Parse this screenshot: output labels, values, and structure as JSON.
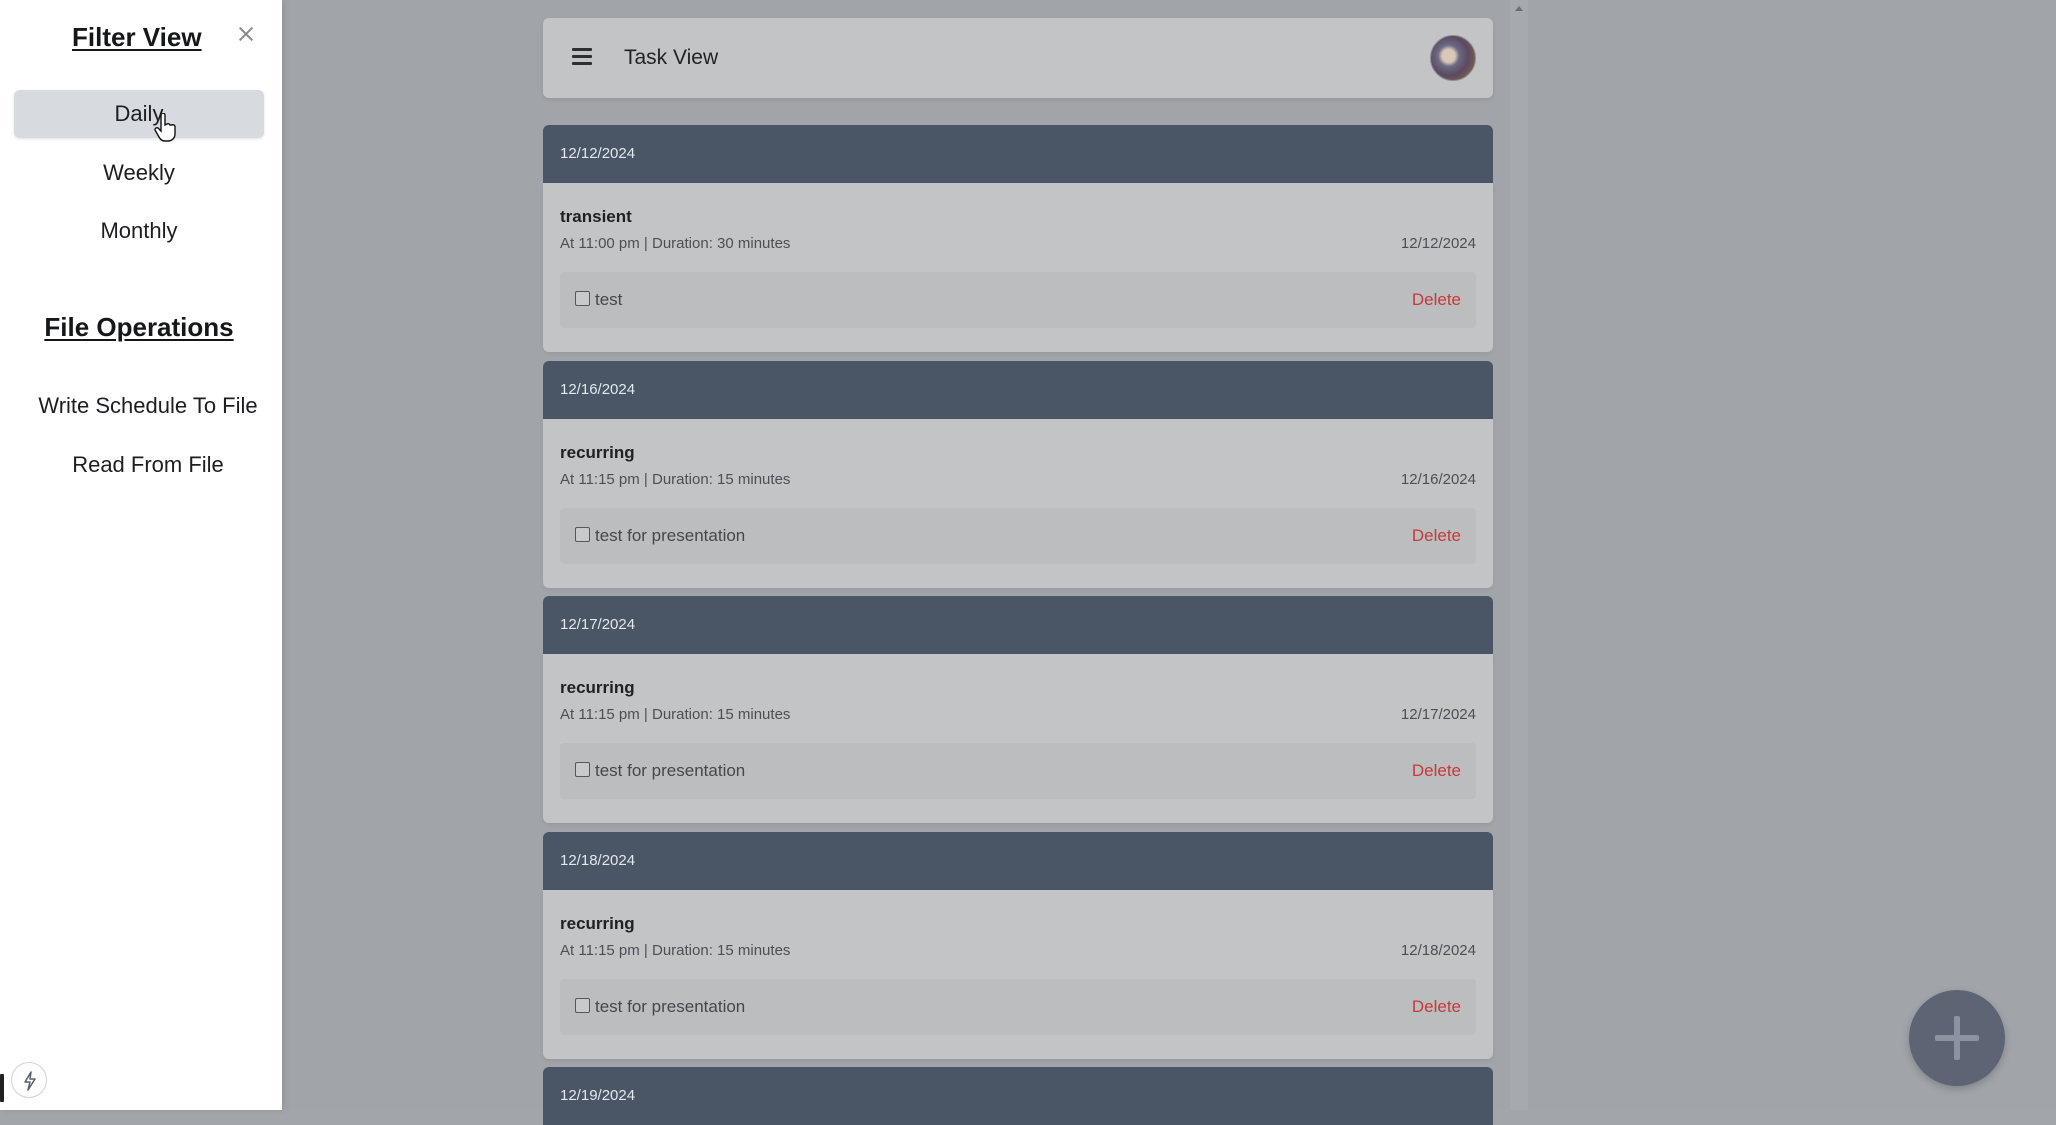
{
  "drawer": {
    "title": "Filter View",
    "filters": [
      {
        "label": "Daily",
        "active": true
      },
      {
        "label": "Weekly",
        "active": false
      },
      {
        "label": "Monthly",
        "active": false
      }
    ],
    "file_section_title": "File Operations",
    "file_ops": [
      "Write Schedule To File",
      "Read From File"
    ]
  },
  "header": {
    "title": "Task View",
    "menu_icon": "hamburger-icon",
    "avatar": "user-avatar"
  },
  "days": [
    {
      "date": "12/12/2024",
      "task": {
        "name": "transient",
        "meta": "At 11:00 pm | Duration: 30 minutes",
        "date": "12/12/2024"
      },
      "subtask": {
        "label": "test",
        "checked": false,
        "action": "Delete"
      }
    },
    {
      "date": "12/16/2024",
      "task": {
        "name": "recurring",
        "meta": "At 11:15 pm | Duration: 15 minutes",
        "date": "12/16/2024"
      },
      "subtask": {
        "label": "test for presentation",
        "checked": false,
        "action": "Delete"
      }
    },
    {
      "date": "12/17/2024",
      "task": {
        "name": "recurring",
        "meta": "At 11:15 pm | Duration: 15 minutes",
        "date": "12/17/2024"
      },
      "subtask": {
        "label": "test for presentation",
        "checked": false,
        "action": "Delete"
      }
    },
    {
      "date": "12/18/2024",
      "task": {
        "name": "recurring",
        "meta": "At 11:15 pm | Duration: 15 minutes",
        "date": "12/18/2024"
      },
      "subtask": {
        "label": "test for presentation",
        "checked": false,
        "action": "Delete"
      }
    },
    {
      "date": "12/19/2024"
    }
  ],
  "colors": {
    "day_header_bg": "#4a5566",
    "delete": "#c6393c",
    "fab": "#5d6575"
  },
  "fab_icon": "plus-icon"
}
